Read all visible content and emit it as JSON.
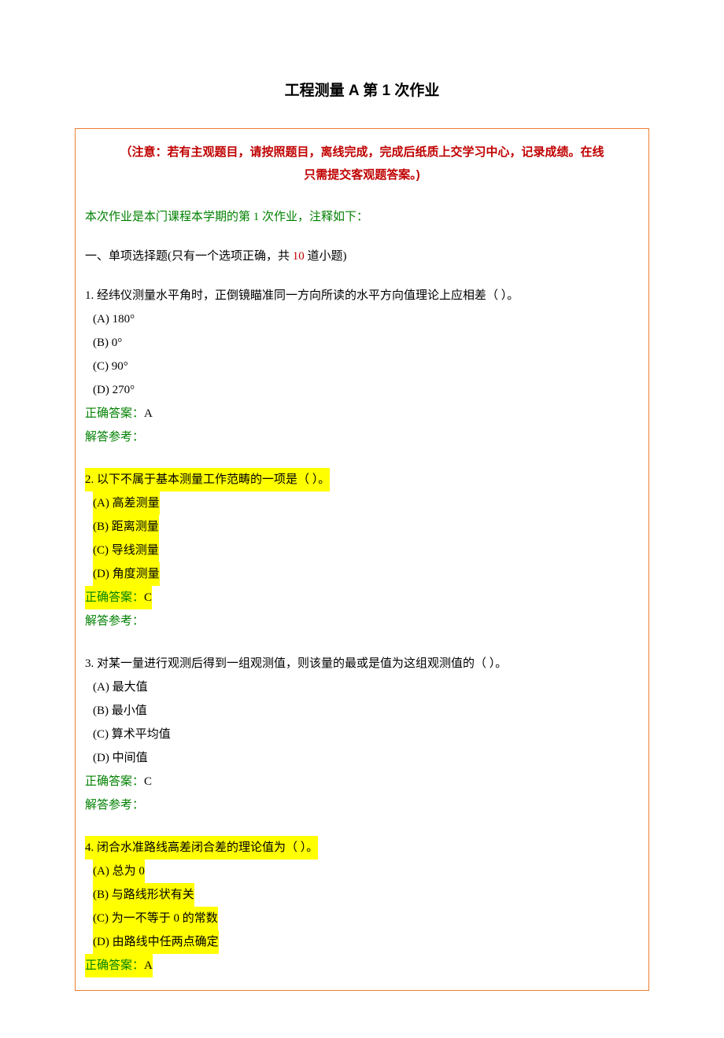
{
  "title": "工程测量 A 第 1 次作业",
  "notice_line1": "（注意：若有主观题目，请按照题目，离线完成，完成后纸质上交学习中心，记录成绩。在线",
  "notice_line2": "只需提交客观题答案。)",
  "intro": "本次作业是本门课程本学期的第 1 次作业，注释如下：",
  "section": {
    "prefix": "一、单项选择题(只有一个选项正确，共 ",
    "count": "10",
    "suffix": " 道小题)"
  },
  "labels": {
    "correct_prefix": "正确答案：",
    "ref": "解答参考："
  },
  "q1": {
    "stem": "1.  经纬仪测量水平角时，正倒镜瞄准同一方向所读的水平方向值理论上应相差（    ）。",
    "a": "(A) 180°",
    "b": "(B) 0°",
    "c": "(C) 90°",
    "d": "(D) 270°",
    "ans": "A"
  },
  "q2": {
    "stem": "2.  以下不属于基本测量工作范畴的一项是（    ）。",
    "a": "(A) 高差测量",
    "b": "(B) 距离测量",
    "c": "(C) 导线测量",
    "d": "(D) 角度测量",
    "ans": "C"
  },
  "q3": {
    "stem": "3.  对某一量进行观测后得到一组观测值，则该量的最或是值为这组观测值的（    ）。",
    "a": "(A) 最大值",
    "b": "(B) 最小值",
    "c": "(C) 算术平均值",
    "d": "(D) 中间值",
    "ans": "C"
  },
  "q4": {
    "stem": "4.  闭合水准路线高差闭合差的理论值为（    ）。",
    "a": "(A) 总为 0",
    "b": "(B) 与路线形状有关",
    "c": "(C) 为一不等于 0 的常数",
    "d": "(D) 由路线中任两点确定",
    "ans": "A"
  }
}
